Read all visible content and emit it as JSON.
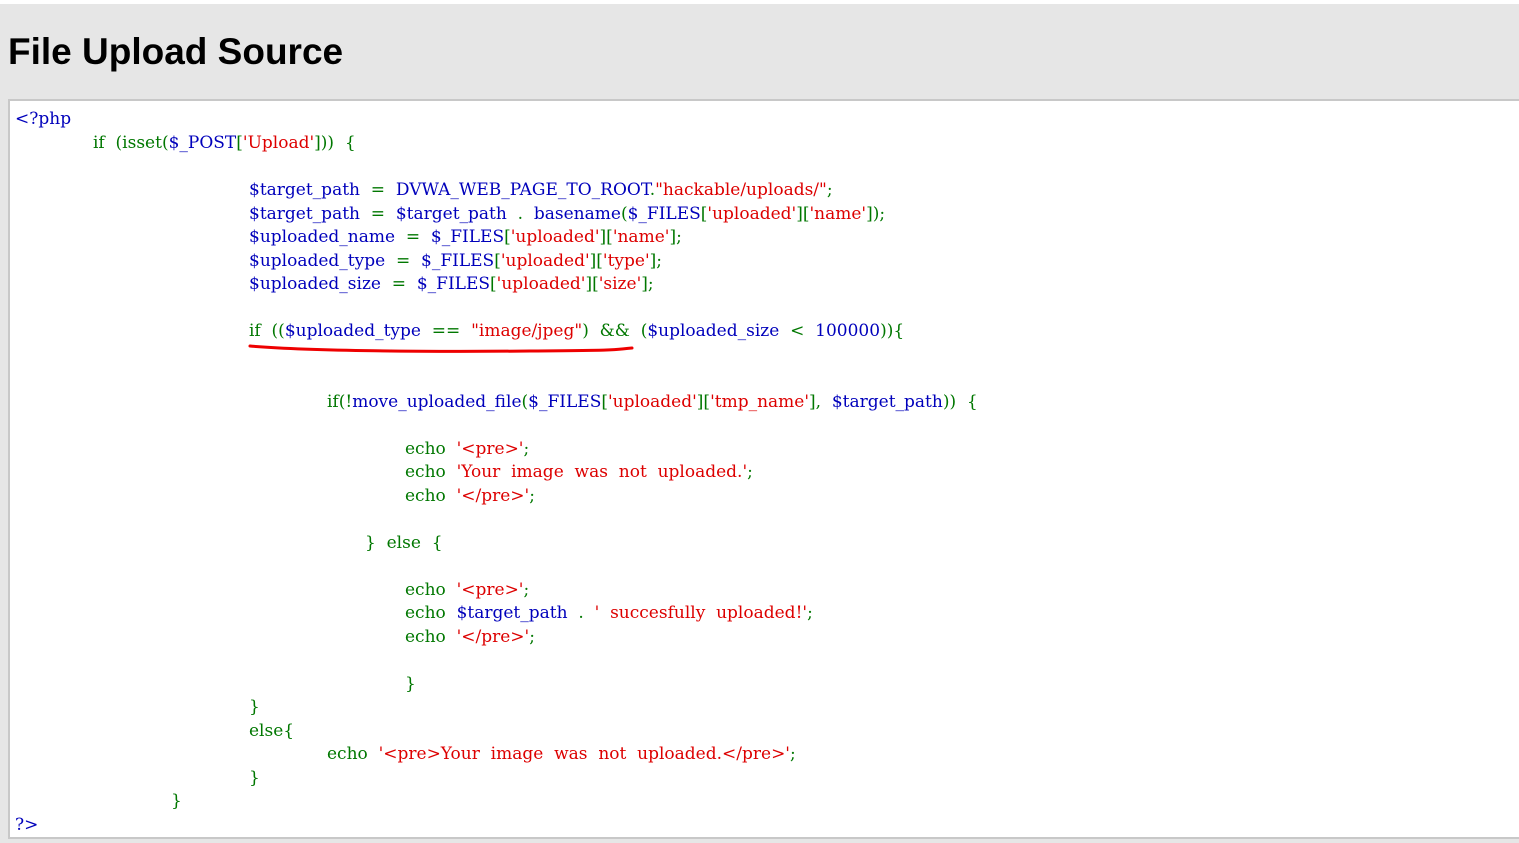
{
  "page": {
    "title": "File Upload Source"
  },
  "code": {
    "lines": [
      [
        {
          "c": "b",
          "t": "<?php"
        }
      ],
      [
        {
          "c": "g",
          "t": "if  (isset("
        },
        {
          "c": "b",
          "t": "$_POST"
        },
        {
          "c": "g",
          "t": "["
        },
        {
          "c": "r",
          "t": "'Upload'"
        },
        {
          "c": "g",
          "t": "]))  {"
        }
      ],
      [],
      [
        {
          "c": "b",
          "t": "$target_path  "
        },
        {
          "c": "g",
          "t": "=  "
        },
        {
          "c": "b",
          "t": "DVWA_WEB_PAGE_TO_ROOT"
        },
        {
          "c": "g",
          "t": "."
        },
        {
          "c": "r",
          "t": "\"hackable/uploads/\""
        },
        {
          "c": "g",
          "t": ";"
        }
      ],
      [
        {
          "c": "b",
          "t": "$target_path  "
        },
        {
          "c": "g",
          "t": "=  "
        },
        {
          "c": "b",
          "t": "$target_path  "
        },
        {
          "c": "g",
          "t": ".  "
        },
        {
          "c": "b",
          "t": "basename"
        },
        {
          "c": "g",
          "t": "("
        },
        {
          "c": "b",
          "t": "$_FILES"
        },
        {
          "c": "g",
          "t": "["
        },
        {
          "c": "r",
          "t": "'uploaded'"
        },
        {
          "c": "g",
          "t": "]["
        },
        {
          "c": "r",
          "t": "'name'"
        },
        {
          "c": "g",
          "t": "]);"
        }
      ],
      [
        {
          "c": "b",
          "t": "$uploaded_name  "
        },
        {
          "c": "g",
          "t": "=  "
        },
        {
          "c": "b",
          "t": "$_FILES"
        },
        {
          "c": "g",
          "t": "["
        },
        {
          "c": "r",
          "t": "'uploaded'"
        },
        {
          "c": "g",
          "t": "]["
        },
        {
          "c": "r",
          "t": "'name'"
        },
        {
          "c": "g",
          "t": "];"
        }
      ],
      [
        {
          "c": "b",
          "t": "$uploaded_type  "
        },
        {
          "c": "g",
          "t": "=  "
        },
        {
          "c": "b",
          "t": "$_FILES"
        },
        {
          "c": "g",
          "t": "["
        },
        {
          "c": "r",
          "t": "'uploaded'"
        },
        {
          "c": "g",
          "t": "]["
        },
        {
          "c": "r",
          "t": "'type'"
        },
        {
          "c": "g",
          "t": "];"
        }
      ],
      [
        {
          "c": "b",
          "t": "$uploaded_size  "
        },
        {
          "c": "g",
          "t": "=  "
        },
        {
          "c": "b",
          "t": "$_FILES"
        },
        {
          "c": "g",
          "t": "["
        },
        {
          "c": "r",
          "t": "'uploaded'"
        },
        {
          "c": "g",
          "t": "]["
        },
        {
          "c": "r",
          "t": "'size'"
        },
        {
          "c": "g",
          "t": "];"
        }
      ],
      [],
      [
        {
          "c": "g",
          "t": "if  (("
        },
        {
          "c": "b",
          "t": "$uploaded_type  "
        },
        {
          "c": "g",
          "t": "==  "
        },
        {
          "c": "r",
          "t": "\"image/jpeg\""
        },
        {
          "c": "g",
          "t": ")  &&  ("
        },
        {
          "c": "b",
          "t": "$uploaded_size  "
        },
        {
          "c": "g",
          "t": "<  "
        },
        {
          "c": "b",
          "t": "100000"
        },
        {
          "c": "g",
          "t": ")){"
        }
      ],
      [],
      [],
      [
        {
          "c": "g",
          "t": "if(!"
        },
        {
          "c": "b",
          "t": "move_uploaded_file"
        },
        {
          "c": "g",
          "t": "("
        },
        {
          "c": "b",
          "t": "$_FILES"
        },
        {
          "c": "g",
          "t": "["
        },
        {
          "c": "r",
          "t": "'uploaded'"
        },
        {
          "c": "g",
          "t": "]["
        },
        {
          "c": "r",
          "t": "'tmp_name'"
        },
        {
          "c": "g",
          "t": "],  "
        },
        {
          "c": "b",
          "t": "$target_path"
        },
        {
          "c": "g",
          "t": "))  {"
        }
      ],
      [],
      [
        {
          "c": "g",
          "t": "echo  "
        },
        {
          "c": "r",
          "t": "'<pre>'"
        },
        {
          "c": "g",
          "t": ";"
        }
      ],
      [
        {
          "c": "g",
          "t": "echo  "
        },
        {
          "c": "r",
          "t": "'Your  image  was  not  uploaded.'"
        },
        {
          "c": "g",
          "t": ";"
        }
      ],
      [
        {
          "c": "g",
          "t": "echo  "
        },
        {
          "c": "r",
          "t": "'</pre>'"
        },
        {
          "c": "g",
          "t": ";"
        }
      ],
      [],
      [
        {
          "c": "g",
          "t": "}  else  {"
        }
      ],
      [],
      [
        {
          "c": "g",
          "t": "echo  "
        },
        {
          "c": "r",
          "t": "'<pre>'"
        },
        {
          "c": "g",
          "t": ";"
        }
      ],
      [
        {
          "c": "g",
          "t": "echo  "
        },
        {
          "c": "b",
          "t": "$target_path  "
        },
        {
          "c": "g",
          "t": ".  "
        },
        {
          "c": "r",
          "t": "'  succesfully  uploaded!'"
        },
        {
          "c": "g",
          "t": ";"
        }
      ],
      [
        {
          "c": "g",
          "t": "echo  "
        },
        {
          "c": "r",
          "t": "'</pre>'"
        },
        {
          "c": "g",
          "t": ";"
        }
      ],
      [],
      [
        {
          "c": "g",
          "t": "}"
        }
      ],
      [
        {
          "c": "g",
          "t": "}"
        }
      ],
      [
        {
          "c": "g",
          "t": "else{"
        }
      ],
      [
        {
          "c": "g",
          "t": "echo  "
        },
        {
          "c": "r",
          "t": "'<pre>Your  image  was  not  uploaded.</pre>'"
        },
        {
          "c": "g",
          "t": ";"
        }
      ],
      [
        {
          "c": "g",
          "t": "}"
        }
      ],
      [
        {
          "c": "g",
          "t": "}"
        }
      ],
      [
        {
          "c": "b",
          "t": "?>"
        }
      ]
    ]
  },
  "colors": {
    "keyword": "#007700",
    "default": "#0000bb",
    "string": "#dd0000",
    "annotation": "#ee0000",
    "page_background": "#e6e6e6"
  }
}
